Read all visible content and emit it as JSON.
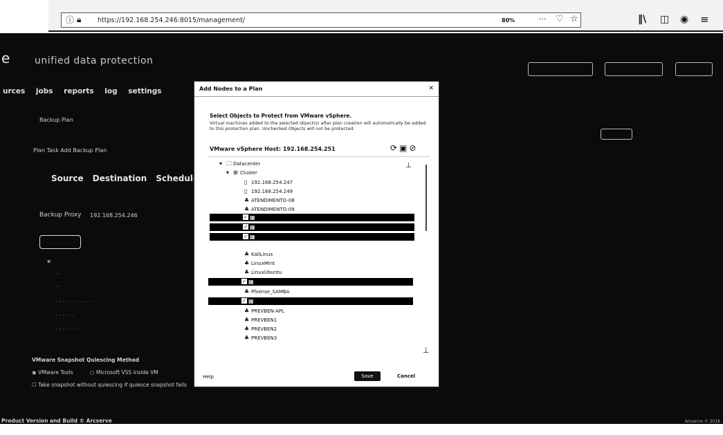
{
  "browser": {
    "url": "https://192.168.254.246:8015/management/",
    "zoom": "80%",
    "more_icon": "···",
    "toolbar_icons": [
      "library-icon",
      "sidebar-icon",
      "account-icon",
      "menu-icon"
    ]
  },
  "app": {
    "logo": "e",
    "title": "unified data protection",
    "header_buttons": [
      "",
      "",
      ""
    ],
    "tabs": [
      "urces",
      "jobs",
      "reports",
      "log",
      "settings"
    ],
    "plan_name_label": "Backup Plan",
    "plan_row_text": "Plan  Task  Add Backup Plan",
    "steps": [
      "Source",
      "Destination",
      "Schedule"
    ],
    "backup_proxy_label": "Backup Proxy",
    "backup_proxy_value": "192.168.254.246",
    "snapshot_method_label": "VMware Snapshot Quiescing Method",
    "snapshot_options": [
      "VMware Tools",
      "Microsoft VSS inside VM"
    ],
    "snapshot_note": "Take snapshot without quiescing if quiesce snapshot fails",
    "footer": "Product Version and Build  ©  Arcserve",
    "footer_right": "Arcserve © 2018"
  },
  "modal": {
    "title": "Add Nodes to a Plan",
    "heading": "Select Objects to Protect from VMware vSphere.",
    "description": "Virtual machines added to the selected object(s) after plan creation will automatically be added to this protection plan. Unchecked Objects will not be protected.",
    "host_label": "VMware vSphere Host: 192.168.254.251",
    "tree": [
      {
        "label": "Datacenter",
        "icon": "folder-icon",
        "level": 0
      },
      {
        "label": "Cluster",
        "icon": "cluster-icon",
        "level": 1
      },
      {
        "label": "192.168.254.247",
        "icon": "host-icon",
        "level": 2
      },
      {
        "label": "192.168.254.249",
        "icon": "host-icon",
        "level": 2
      },
      {
        "label": "ATENDIMENTO-08",
        "icon": "vm-icon",
        "level": 2
      },
      {
        "label": "ATENDIMENTO-09",
        "icon": "vm-icon",
        "level": 2
      },
      {
        "label": "KaliLinux",
        "icon": "vm-icon",
        "level": 2
      },
      {
        "label": "LinuxMint",
        "icon": "vm-icon",
        "level": 2
      },
      {
        "label": "LinuxUbuntu",
        "icon": "vm-icon",
        "level": 2
      },
      {
        "label": "Pfsense_SAMBA",
        "icon": "vm-icon",
        "level": 2
      },
      {
        "label": "PREVBEN-APL",
        "icon": "vm-icon",
        "level": 2
      },
      {
        "label": "PREVBEN1",
        "icon": "vm-icon",
        "level": 2
      },
      {
        "label": "PREVBEN2",
        "icon": "vm-icon",
        "level": 2
      },
      {
        "label": "PREVBEN3",
        "icon": "vm-icon",
        "level": 2
      }
    ],
    "help": "Help",
    "save": "Save",
    "cancel": "Cancel"
  }
}
